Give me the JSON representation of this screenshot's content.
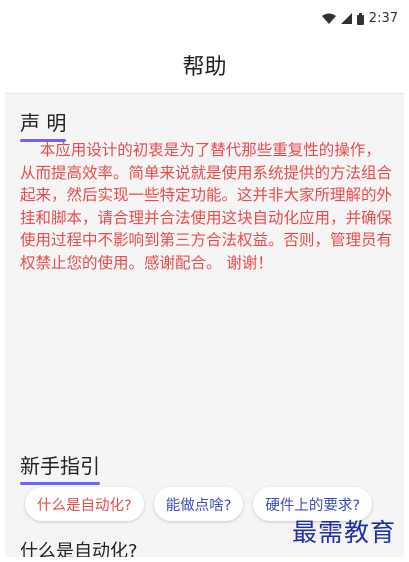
{
  "status_bar": {
    "time": "2:37",
    "icons": [
      "wifi-icon",
      "cellular-signal-icon",
      "battery-icon"
    ]
  },
  "app_bar": {
    "title": "帮助"
  },
  "statement": {
    "title": "声 明",
    "body": "    本应用设计的初衷是为了替代那些重复性的操作，从而提高效率。简单来说就是使用系统提供的方法组合起来，然后实现一些特定功能。这并非大家所理解的外挂和脚本，请合理并合法使用这块自动化应用，并确保使用过程中不影响到第三方合法权益。否则，管理员有权禁止您的使用。感谢配合。 谢谢！"
  },
  "guide": {
    "title": "新手指引",
    "chips": [
      {
        "label": "什么是自动化?",
        "active": true
      },
      {
        "label": "能做点啥?",
        "active": false
      },
      {
        "label": "硬件上的要求?",
        "active": false
      }
    ],
    "current_topic": "什么是自动化?"
  },
  "watermark": "最需教育",
  "colors": {
    "accent": "#6c63ff",
    "statement_text": "#e94b4b",
    "chip_active": "#e94b4b",
    "chip_normal": "#3d4db7"
  }
}
